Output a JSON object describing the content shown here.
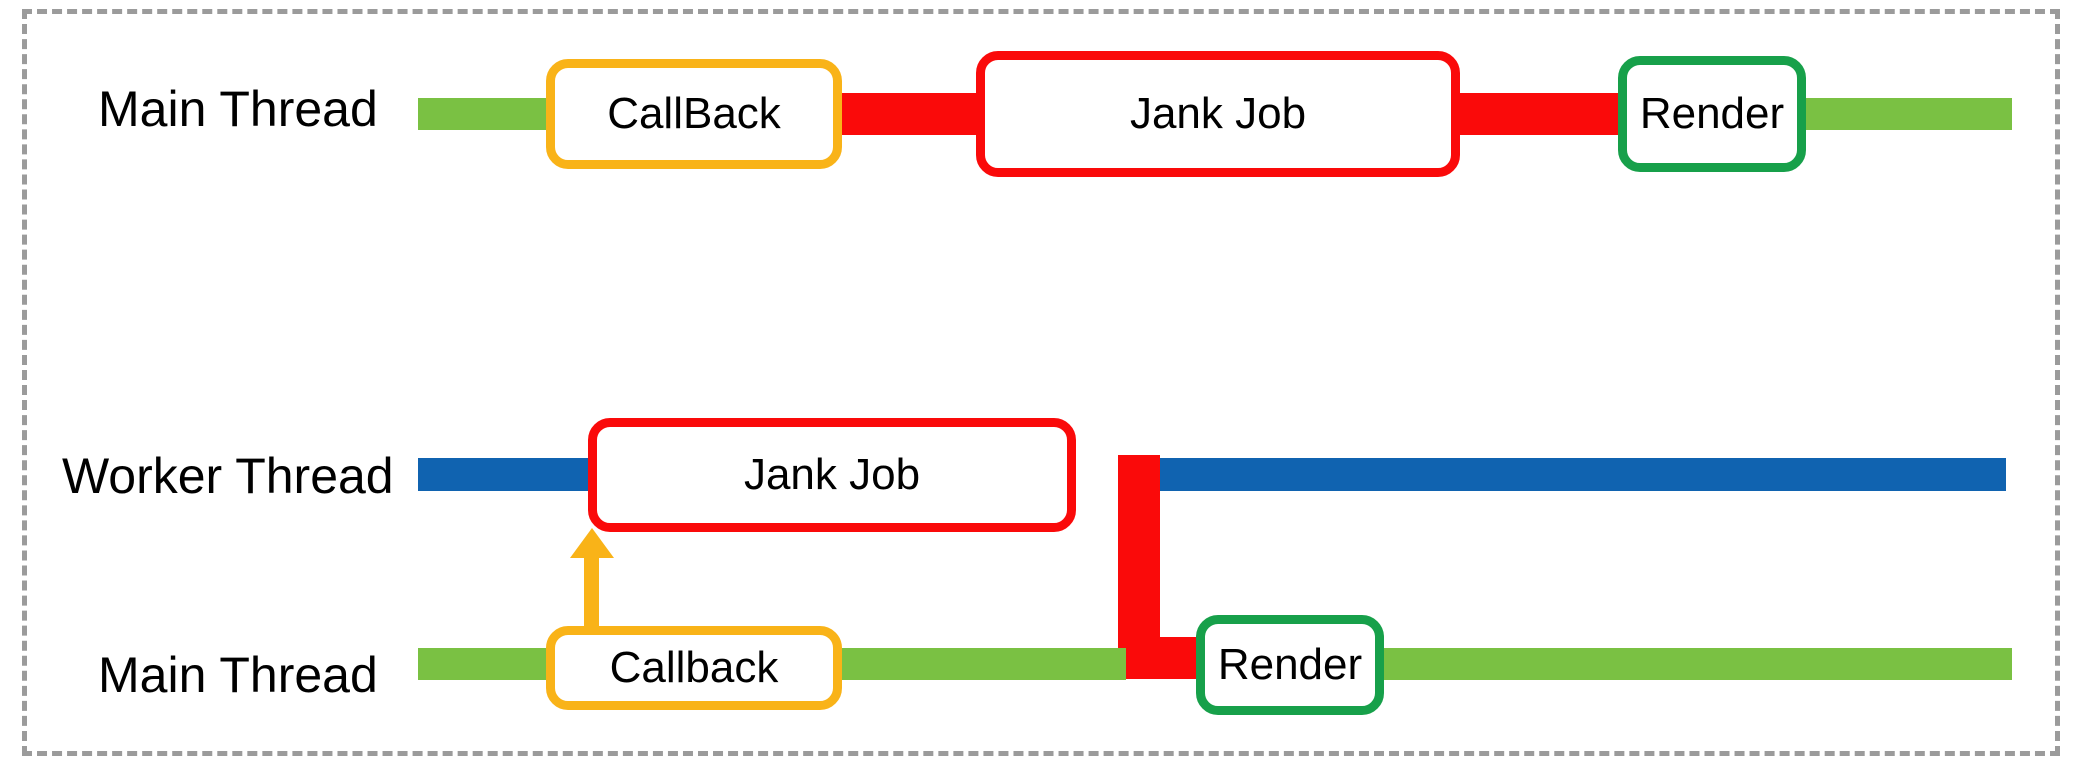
{
  "diagram": {
    "title": "Main thread vs Worker thread jank offloading timeline",
    "frame_style": "dashed",
    "frame_color": "#9b9b9b"
  },
  "colors": {
    "green_idle": "#7ac143",
    "red_busy": "#fa0a0a",
    "blue_worker": "#1063b0",
    "orange_callback": "#f9b318",
    "green_render": "#17a04a",
    "red_jank": "#fa0a0a",
    "frame_gray": "#9b9b9b",
    "text_black": "#000000",
    "box_fill": "#ffffff"
  },
  "rows": [
    {
      "id": "top-main-thread",
      "label": "Main Thread",
      "track_color": "#7ac143",
      "busy_color": "#fa0a0a",
      "boxes": [
        {
          "id": "top-callback",
          "label": "CallBack",
          "border_color": "#f9b318"
        },
        {
          "id": "top-jank-job",
          "label": "Jank Job",
          "border_color": "#fa0a0a"
        },
        {
          "id": "top-render",
          "label": "Render",
          "border_color": "#17a04a"
        }
      ]
    },
    {
      "id": "worker-thread",
      "label": "Worker Thread",
      "track_color": "#1063b0",
      "boxes": [
        {
          "id": "worker-jank-job",
          "label": "Jank Job",
          "border_color": "#fa0a0a"
        }
      ]
    },
    {
      "id": "bottom-main-thread",
      "label": "Main Thread",
      "track_color": "#7ac143",
      "boxes": [
        {
          "id": "bottom-callback",
          "label": "Callback",
          "border_color": "#f9b318"
        },
        {
          "id": "bottom-render",
          "label": "Render",
          "border_color": "#17a04a"
        }
      ]
    }
  ],
  "connectors": [
    {
      "id": "dispatch-arrow",
      "kind": "arrow-up",
      "color": "#f9b318",
      "from": "bottom-callback",
      "to": "worker-jank-job"
    },
    {
      "id": "result-elbow",
      "kind": "elbow",
      "color": "#fa0a0a",
      "from": "worker-jank-job",
      "to": "bottom-render"
    }
  ]
}
